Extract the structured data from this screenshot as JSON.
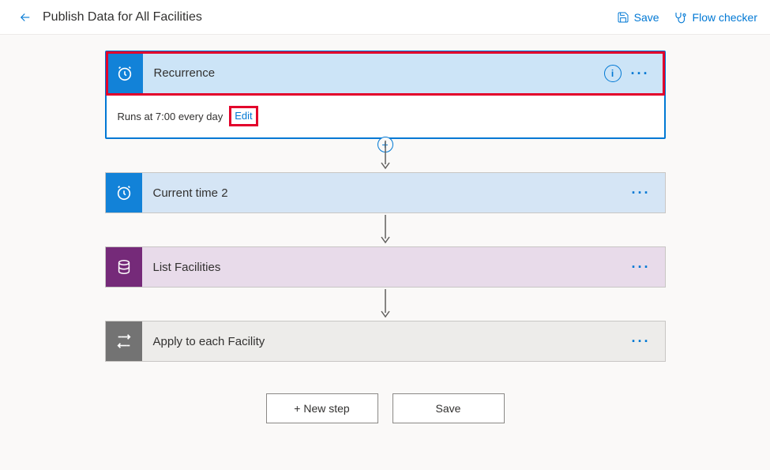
{
  "header": {
    "title": "Publish Data for All Facilities",
    "save_label": "Save",
    "flow_checker_label": "Flow checker"
  },
  "steps": {
    "recurrence": {
      "title": "Recurrence",
      "schedule_text": "Runs at 7:00 every day",
      "edit_label": "Edit"
    },
    "current_time": {
      "title": "Current time 2"
    },
    "list_facilities": {
      "title": "List Facilities"
    },
    "apply_each": {
      "title": "Apply to each Facility"
    }
  },
  "actions": {
    "new_step": "+ New step",
    "save": "Save"
  },
  "colors": {
    "accent": "#0078d4",
    "highlight": "#e3002b"
  }
}
